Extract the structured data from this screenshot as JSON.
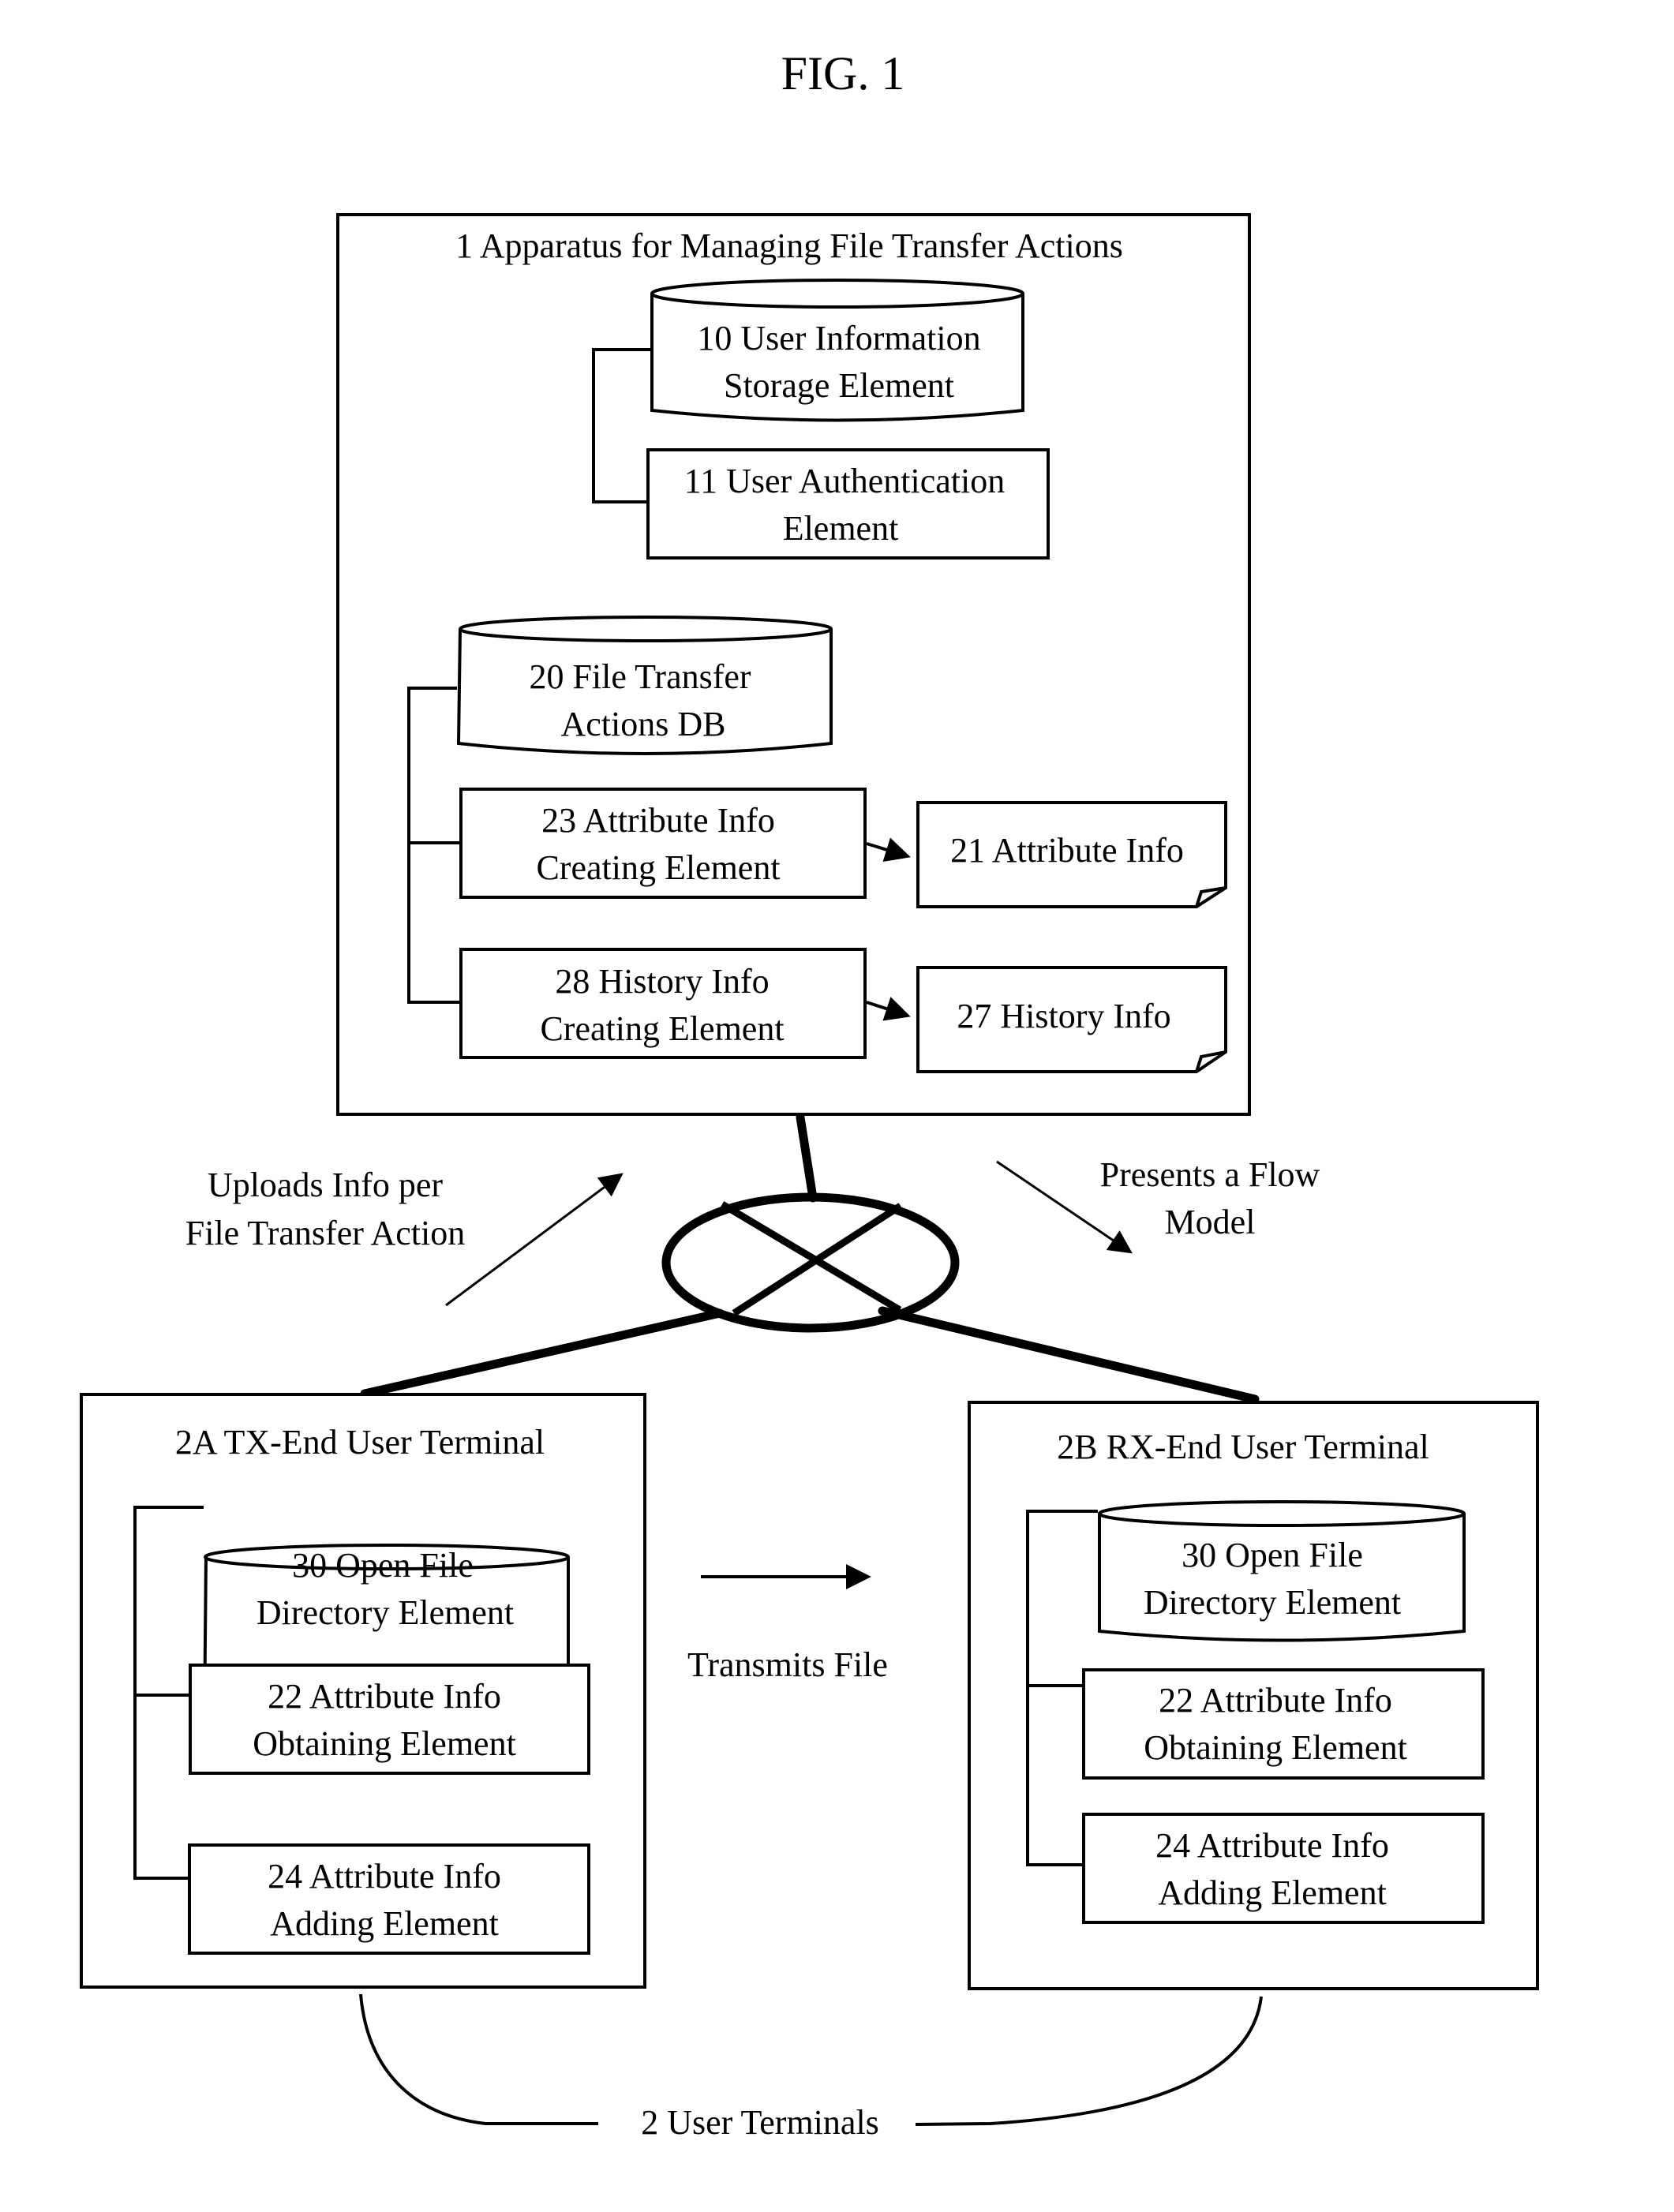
{
  "figure": {
    "title": "FIG. 1"
  },
  "apparatus": {
    "title": "1 Apparatus for Managing File Transfer Actions",
    "user_info_storage": [
      "10 User Information",
      "Storage Element"
    ],
    "user_authentication": [
      "11 User Authentication",
      "Element"
    ],
    "file_transfer_db": [
      "20 File Transfer",
      "Actions DB"
    ],
    "attribute_info_creating": [
      "23 Attribute Info",
      "Creating Element"
    ],
    "attribute_info": "21 Attribute Info",
    "history_info_creating": [
      "28 History Info",
      "Creating Element"
    ],
    "history_info": "27 History Info"
  },
  "flows": {
    "uploads": [
      "Uploads Info per",
      "File Transfer Action"
    ],
    "presents": [
      "Presents a Flow",
      "Model"
    ],
    "transmits": "Transmits File"
  },
  "terminal_tx": {
    "title": "2A TX-End User Terminal",
    "open_file_directory": [
      "30 Open File",
      "Directory Element"
    ],
    "attribute_obtaining": [
      "22 Attribute Info",
      "Obtaining Element"
    ],
    "attribute_adding": [
      "24 Attribute Info",
      "Adding Element"
    ]
  },
  "terminal_rx": {
    "title": "2B RX-End User Terminal",
    "open_file_directory": [
      "30 Open File",
      "Directory Element"
    ],
    "attribute_obtaining": [
      "22 Attribute Info",
      "Obtaining Element"
    ],
    "attribute_adding": [
      "24 Attribute Info",
      "Adding Element"
    ]
  },
  "user_terminals_label": "2 User Terminals"
}
